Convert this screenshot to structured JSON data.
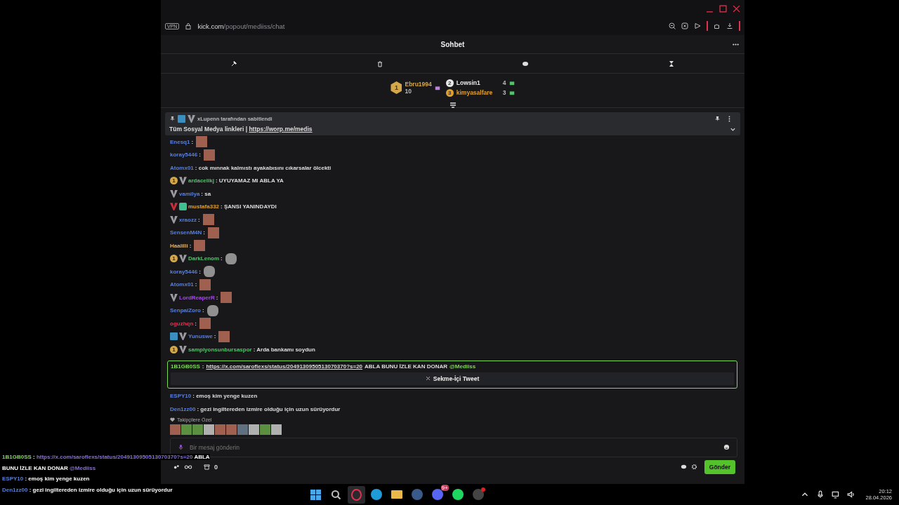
{
  "browser": {
    "vpn": "VPN",
    "url_host": "kick.com",
    "url_path": "/popout/mediiss/chat"
  },
  "chat": {
    "title": "Sohbet"
  },
  "leaderboard": {
    "top": {
      "rank": "1",
      "name": "Ebru1994",
      "count": "10"
    },
    "others": [
      {
        "rank": "2",
        "name": "Lowsin1",
        "count": "4",
        "color": "#e8e8e8"
      },
      {
        "rank": "3",
        "name": "kimyasalfare",
        "count": "3",
        "color": "#e0a030"
      }
    ]
  },
  "pinned": {
    "by_user": "xLupenn",
    "by_text": "tarafından sabitlendi",
    "text": "Tüm Sosyal Medya linkleri | ",
    "link": "https://worp.me/medis"
  },
  "messages": [
    {
      "kind": "face",
      "user": "Enesq1",
      "color": "#5b7fd6",
      "text": ":"
    },
    {
      "kind": "face",
      "user": "koray5446",
      "color": "#5b7fd6",
      "text": ":"
    },
    {
      "kind": "text",
      "user": "Atomx01",
      "color": "#5b7fd6",
      "text": ": cok mınnak kalmıstı ayakabısını cıkarsalar ölcekti"
    },
    {
      "kind": "text",
      "user": "ardacelikj",
      "color": "#53c26a",
      "badges": [
        {
          "kind": "sub",
          "label": "1"
        },
        {
          "kind": "og"
        }
      ],
      "text": ": UYUYAMAZ MI ABLA YA"
    },
    {
      "kind": "text",
      "user": "vamilya",
      "color": "#5b7fd6",
      "badges": [
        {
          "kind": "og"
        }
      ],
      "text": ": sa"
    },
    {
      "kind": "text",
      "user": "mustafa332",
      "color": "#e0a030",
      "badges": [
        {
          "kind": "og-red"
        },
        {
          "kind": "gift"
        }
      ],
      "text": ": ŞANSI YANINDAYDI"
    },
    {
      "kind": "face",
      "user": "xraozz",
      "color": "#5b7fd6",
      "badges": [
        {
          "kind": "og"
        }
      ],
      "text": ":"
    },
    {
      "kind": "face",
      "user": "SensenM4N",
      "color": "#5b7fd6",
      "text": ":"
    },
    {
      "kind": "face",
      "user": "Haalilli",
      "color": "#d8b070",
      "text": ":"
    },
    {
      "kind": "sticker",
      "user": "DarkLenom",
      "color": "#53c26a",
      "badges": [
        {
          "kind": "sub",
          "label": "1"
        },
        {
          "kind": "og"
        }
      ],
      "text": ":"
    },
    {
      "kind": "sticker",
      "user": "koray5446",
      "color": "#5b7fd6",
      "text": ":"
    },
    {
      "kind": "face",
      "user": "Atomx01",
      "color": "#5b7fd6",
      "text": ":"
    },
    {
      "kind": "face",
      "user": "LordReaperR",
      "color": "#a24be0",
      "badges": [
        {
          "kind": "og"
        }
      ],
      "text": ":"
    },
    {
      "kind": "sticker",
      "user": "SenpaiZoro",
      "color": "#5b7fd6",
      "text": ":"
    },
    {
      "kind": "face",
      "user": "oguzhqn",
      "color": "#e0334f",
      "text": ":"
    },
    {
      "kind": "face",
      "user": "Yunuswe",
      "color": "#5b7fd6",
      "badges": [
        {
          "kind": "mod"
        },
        {
          "kind": "og"
        }
      ],
      "text": ":"
    },
    {
      "kind": "text",
      "user": "sampiyonsunbursaspor",
      "color": "#53c26a",
      "badges": [
        {
          "kind": "sub",
          "label": "1"
        },
        {
          "kind": "og"
        }
      ],
      "text": ": Arda bankamı soydun"
    }
  ],
  "highlight": {
    "user": "1B1GB0SS",
    "color": "#7ed957",
    "sep": ":",
    "link": "https://x.com/saroflexs/status/2049130950513070370?s=20",
    "text": "ABLA BUNU İZLE KAN DONAR",
    "mention": "@Mediiss",
    "embed": "Sekme-İçi Tweet"
  },
  "later_messages": [
    {
      "user": "ESPY10",
      "color": "#5b7fd6",
      "text": ": emoş kim yenge kuzen"
    },
    {
      "user": "Den1zz00",
      "color": "#5b7fd6",
      "text": ": gezi ingiltereden izmire olduğu için uzun sürüyordur"
    }
  ],
  "followers_emotes": {
    "label": "Takipçilere Özel",
    "emotes": [
      {
        "kind": "face"
      },
      {
        "kind": "frog"
      },
      {
        "kind": "frog"
      },
      {
        "kind": "cat"
      },
      {
        "kind": "face"
      },
      {
        "kind": "face"
      },
      {
        "kind": "bird"
      },
      {
        "kind": "cat"
      },
      {
        "kind": "frog"
      },
      {
        "kind": "cat"
      }
    ]
  },
  "input": {
    "placeholder": "Bir mesaj gönderin"
  },
  "footer": {
    "points": "0",
    "send": "Gönder"
  },
  "overlay": [
    {
      "user": "1B1GB0SS",
      "color": "#7ed957",
      "sep": " : ",
      "link": "https://x.com/saroflexs/status/2049130950513070370?s=20",
      "text": " ABLA"
    },
    {
      "text": "BUNU İZLE KAN DONAR ",
      "mention": "@Mediiss"
    },
    {
      "user": "ESPY10",
      "color": "#5b7fd6",
      "sep": " : ",
      "text": "emoş kim yenge kuzen"
    },
    {
      "user": "Den1zz00",
      "color": "#5b7fd6",
      "sep": " : ",
      "text": "gezi ingiltereden izmire olduğu için uzun sürüyordur"
    }
  ],
  "taskbar": {
    "apps": [
      {
        "kind": "windows",
        "selected": false
      },
      {
        "kind": "search",
        "selected": false
      },
      {
        "kind": "opera",
        "selected": true
      },
      {
        "kind": "edge",
        "selected": false
      },
      {
        "kind": "folder",
        "selected": false
      },
      {
        "kind": "steam",
        "selected": false
      },
      {
        "kind": "discord",
        "selected": false,
        "badge": "9+"
      },
      {
        "kind": "spotify",
        "selected": false
      },
      {
        "kind": "obs",
        "selected": false
      }
    ],
    "time": "20:12",
    "date": "28.04.2026"
  }
}
